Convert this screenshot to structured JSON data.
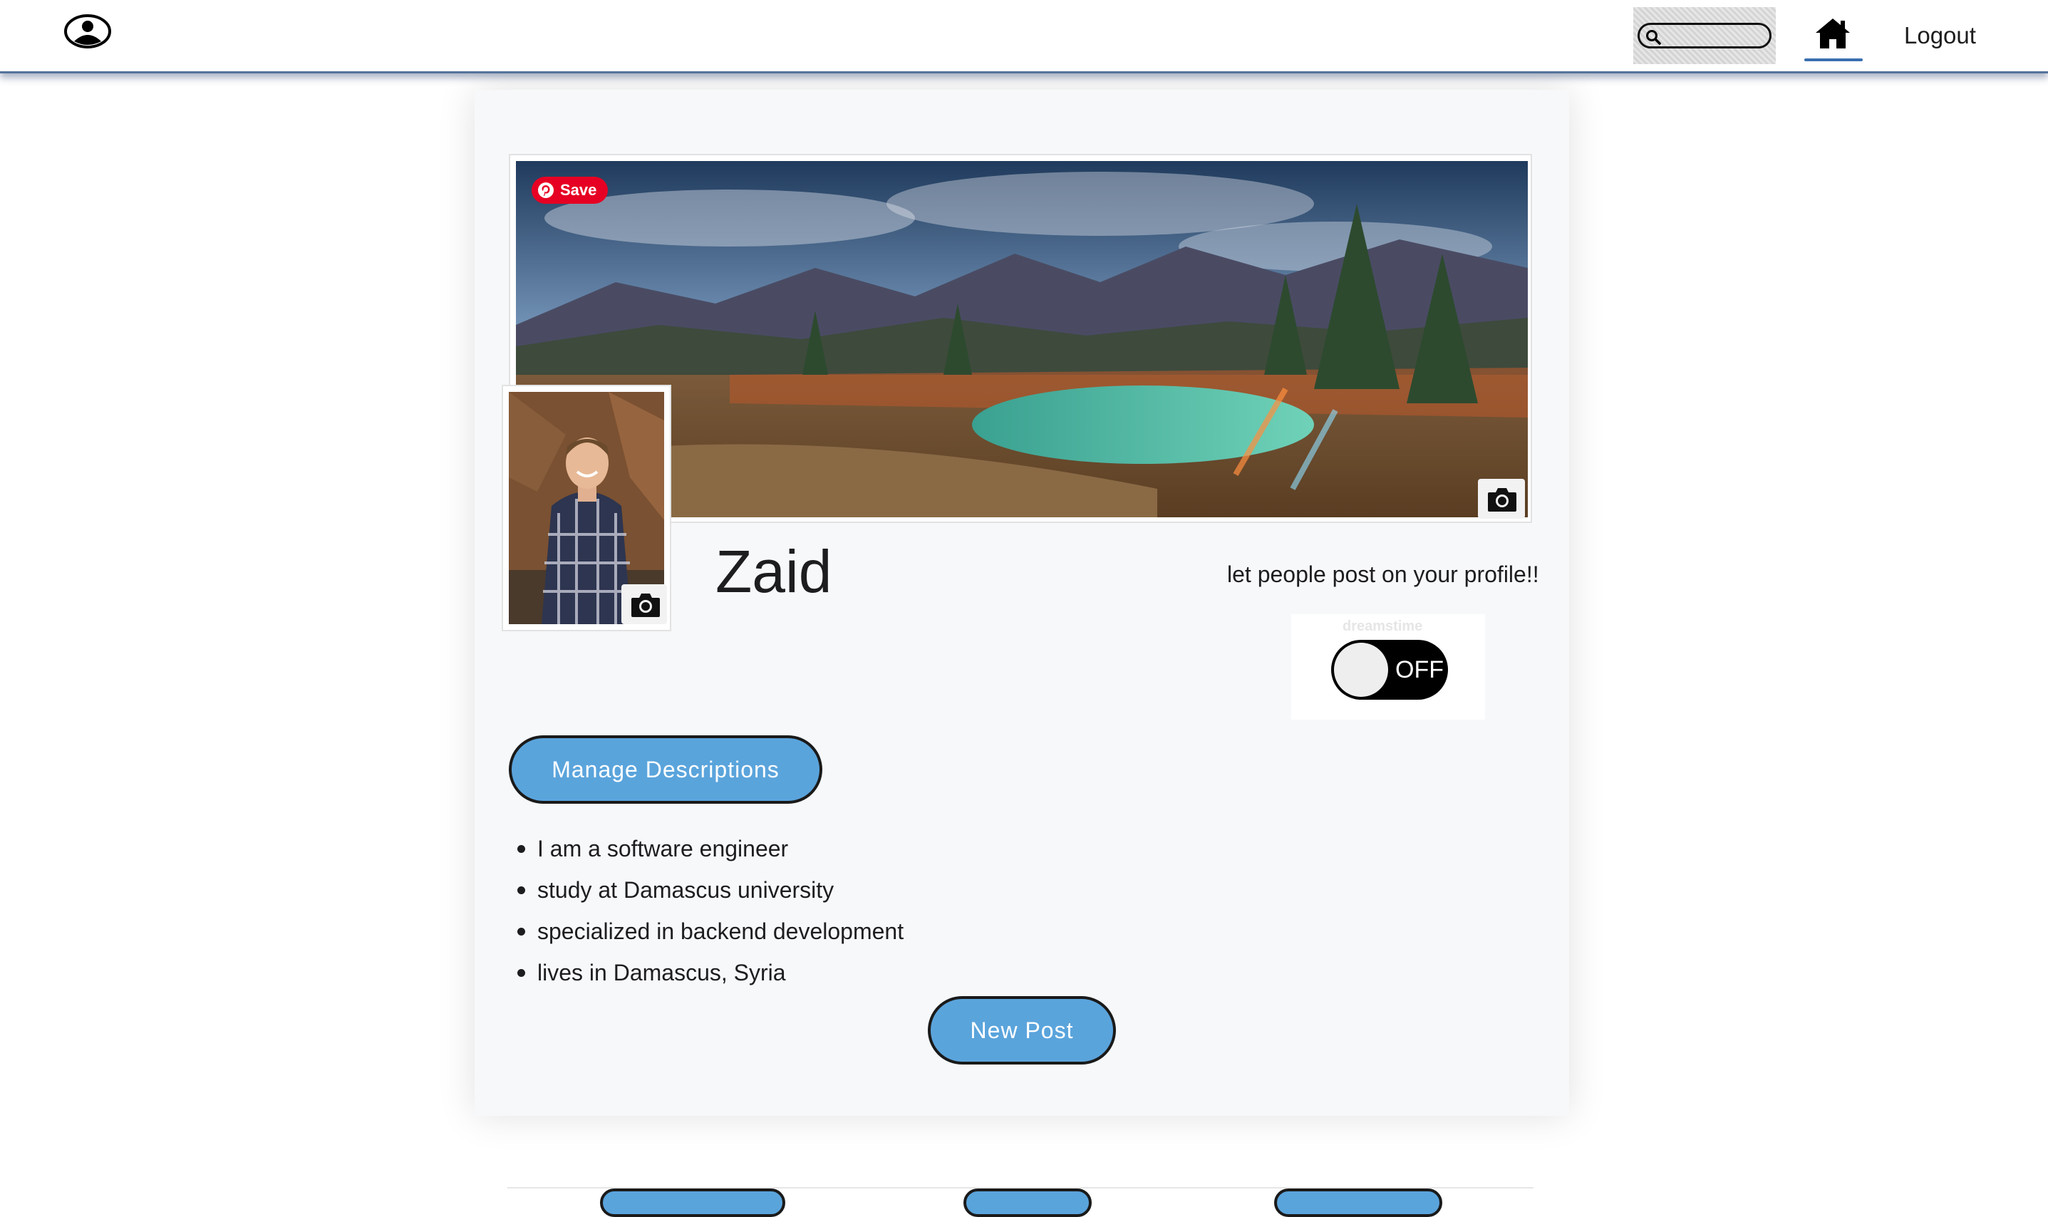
{
  "navbar": {
    "logo_icon": "user-circle-icon",
    "search": {
      "placeholder": "",
      "value": "",
      "icon": "search-icon"
    },
    "home_icon": "home-icon",
    "logout_label": "Logout"
  },
  "cover": {
    "save_label": "Save",
    "save_icon": "pinterest-icon",
    "camera_icon": "camera-icon"
  },
  "avatar": {
    "camera_icon": "camera-icon"
  },
  "profile": {
    "name": "Zaid",
    "toggle_caption": "let people post on your profile!!",
    "toggle_watermark": "dreamstime",
    "toggle_state": "OFF"
  },
  "descriptions": {
    "manage_label": "Manage Descriptions",
    "items": [
      "I am a software engineer",
      "study at Damascus university",
      "specialized in backend development",
      "lives in Damascus, Syria"
    ]
  },
  "posts": {
    "new_post_label": "New Post"
  },
  "colors": {
    "button": "#5aa4dc",
    "nav_border": "#55739b",
    "card_bg": "#f7f8fa",
    "save_red": "#e60023"
  }
}
